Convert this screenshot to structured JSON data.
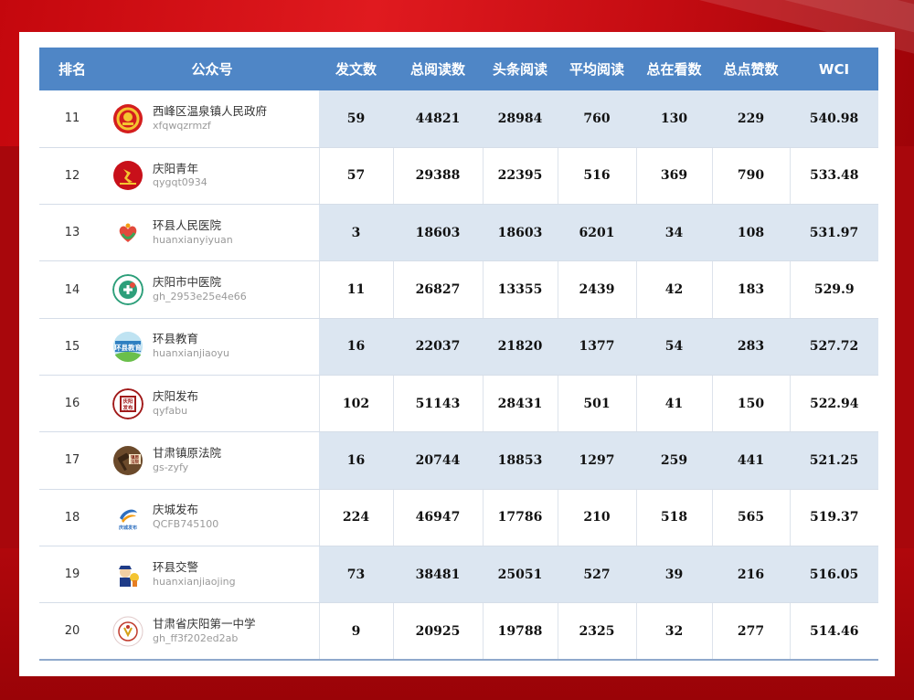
{
  "headers": [
    "排名",
    "公众号",
    "发文数",
    "总阅读数",
    "头条阅读",
    "平均阅读",
    "总在看数",
    "总点赞数",
    "WCI"
  ],
  "colors": {
    "header": "#4f86c6",
    "shaded": "#dce6f1",
    "background": "#c4070d"
  },
  "rows": [
    {
      "rank": "11",
      "name": "西峰区温泉镇人民政府",
      "id": "xfqwqzrmzf",
      "posts": "59",
      "total_reads": "44821",
      "headline_reads": "28984",
      "avg_reads": "760",
      "watching": "130",
      "likes": "229",
      "wci": "540.98",
      "icon": "national-emblem-icon",
      "logo_text": "",
      "shaded": true
    },
    {
      "rank": "12",
      "name": "庆阳青年",
      "id": "qygqt0934",
      "posts": "57",
      "total_reads": "29388",
      "headline_reads": "22395",
      "avg_reads": "516",
      "watching": "369",
      "likes": "790",
      "wci": "533.48",
      "icon": "youth-league-icon",
      "logo_text": "",
      "shaded": false
    },
    {
      "rank": "13",
      "name": "环县人民医院",
      "id": "huanxianyiyuan",
      "posts": "3",
      "total_reads": "18603",
      "headline_reads": "18603",
      "avg_reads": "6201",
      "watching": "34",
      "likes": "108",
      "wci": "531.97",
      "icon": "hospital-heart-icon",
      "logo_text": "",
      "shaded": true
    },
    {
      "rank": "14",
      "name": "庆阳市中医院",
      "id": "gh_2953e25e4e66",
      "posts": "11",
      "total_reads": "26827",
      "headline_reads": "13355",
      "avg_reads": "2439",
      "watching": "42",
      "likes": "183",
      "wci": "529.9",
      "icon": "tcm-hospital-icon",
      "logo_text": "",
      "shaded": false
    },
    {
      "rank": "15",
      "name": "环县教育",
      "id": "huanxianjiaoyu",
      "posts": "16",
      "total_reads": "22037",
      "headline_reads": "21820",
      "avg_reads": "1377",
      "watching": "54",
      "likes": "283",
      "wci": "527.72",
      "icon": "education-icon",
      "logo_text": "环县教育",
      "shaded": true
    },
    {
      "rank": "16",
      "name": "庆阳发布",
      "id": "qyfabu",
      "posts": "102",
      "total_reads": "51143",
      "headline_reads": "28431",
      "avg_reads": "501",
      "watching": "41",
      "likes": "150",
      "wci": "522.94",
      "icon": "seal-icon",
      "logo_text": "庆阳发布",
      "shaded": false
    },
    {
      "rank": "17",
      "name": "甘肃镇原法院",
      "id": "gs-zyfy",
      "posts": "16",
      "total_reads": "20744",
      "headline_reads": "18853",
      "avg_reads": "1297",
      "watching": "259",
      "likes": "441",
      "wci": "521.25",
      "icon": "gavel-icon",
      "logo_text": "镇原法院",
      "shaded": true
    },
    {
      "rank": "18",
      "name": "庆城发布",
      "id": "QCFB745100",
      "posts": "224",
      "total_reads": "46947",
      "headline_reads": "17786",
      "avg_reads": "210",
      "watching": "518",
      "likes": "565",
      "wci": "519.37",
      "icon": "swoosh-icon",
      "logo_text": "庆城发布",
      "shaded": false
    },
    {
      "rank": "19",
      "name": "环县交警",
      "id": "huanxianjiaojing",
      "posts": "73",
      "total_reads": "38481",
      "headline_reads": "25051",
      "avg_reads": "527",
      "watching": "39",
      "likes": "216",
      "wci": "516.05",
      "icon": "police-icon",
      "logo_text": "",
      "shaded": true
    },
    {
      "rank": "20",
      "name": "甘肃省庆阳第一中学",
      "id": "gh_ff3f202ed2ab",
      "posts": "9",
      "total_reads": "20925",
      "headline_reads": "19788",
      "avg_reads": "2325",
      "watching": "32",
      "likes": "277",
      "wci": "514.46",
      "icon": "school-icon",
      "logo_text": "",
      "shaded": false
    }
  ]
}
